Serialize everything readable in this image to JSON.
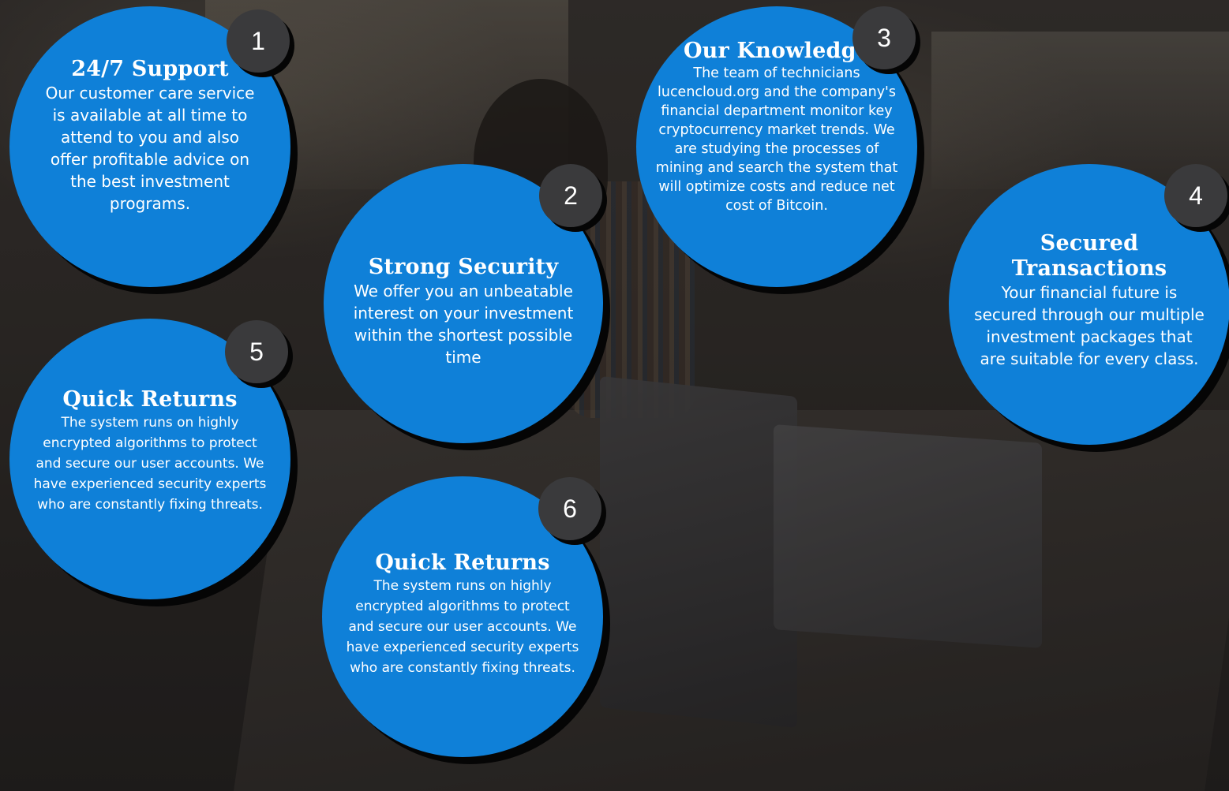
{
  "features": [
    {
      "number": "1",
      "title": "24/7 Support",
      "text": "Our customer care service is available at all time to attend to you and also offer profitable advice on the best investment programs."
    },
    {
      "number": "2",
      "title": "Strong Security",
      "text": "We offer you an unbeatable interest on your investment within the shortest possible time"
    },
    {
      "number": "3",
      "title": "Our Knowledge",
      "text": "The team of technicians lucencloud.org and the company's financial department monitor key cryptocurrency market trends. We are studying the processes of mining and search the system that will optimize costs and reduce net cost of Bitcoin."
    },
    {
      "number": "4",
      "title": "Secured Transactions",
      "text": "Your financial future is secured through our multiple investment packages that are suitable for every class."
    },
    {
      "number": "5",
      "title": "Quick Returns",
      "text": "The system runs on highly encrypted algorithms to protect and secure our user accounts. We have experienced security experts who are constantly fixing threats."
    },
    {
      "number": "6",
      "title": "Quick Returns",
      "text": "The system runs on highly encrypted algorithms to protect and secure our user accounts. We have experienced security experts who are constantly fixing threats."
    }
  ],
  "colors": {
    "circle": "#0f80d8",
    "badge": "#3a3a3c",
    "shadow": "#050505"
  }
}
